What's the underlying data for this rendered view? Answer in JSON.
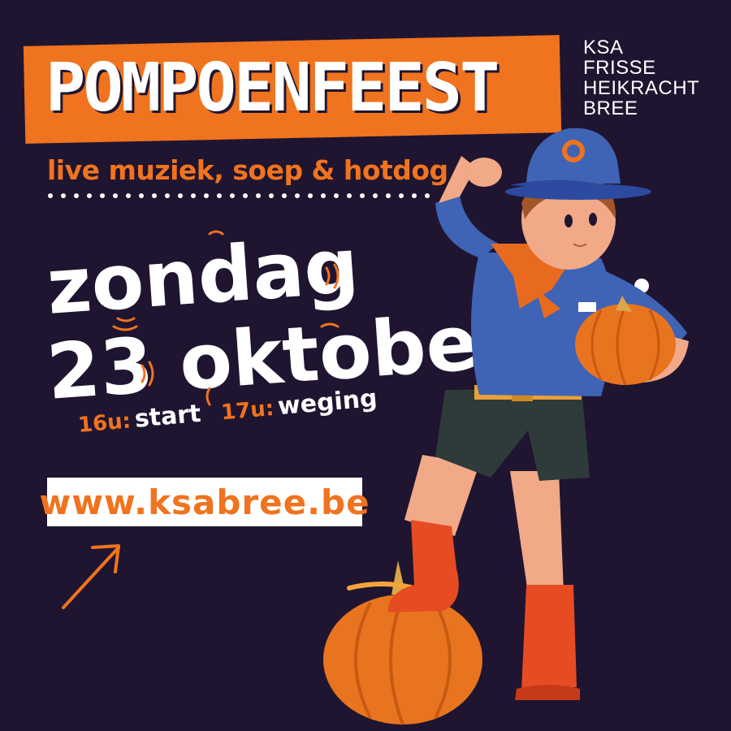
{
  "title": "POMPOENFEEST",
  "organization": [
    "KSA",
    "FRISSE",
    "HEIKRACHT",
    "BREE"
  ],
  "tagline": "live muziek, soep & hotdog",
  "date": {
    "line1": "zondag",
    "line2": "23 oktober"
  },
  "schedule": [
    {
      "time": "16u:",
      "label": "start"
    },
    {
      "time": "17u:",
      "label": "weging"
    }
  ],
  "website": "www.ksabree.be",
  "colors": {
    "background": "#1f1530",
    "accent": "#f0731f",
    "text": "#ffffff",
    "uniform": "#3f63b5",
    "shorts": "#2f3a3a"
  },
  "icons": [
    "arrow-up-right-icon",
    "pumpkin-icon",
    "scout-illustration"
  ]
}
